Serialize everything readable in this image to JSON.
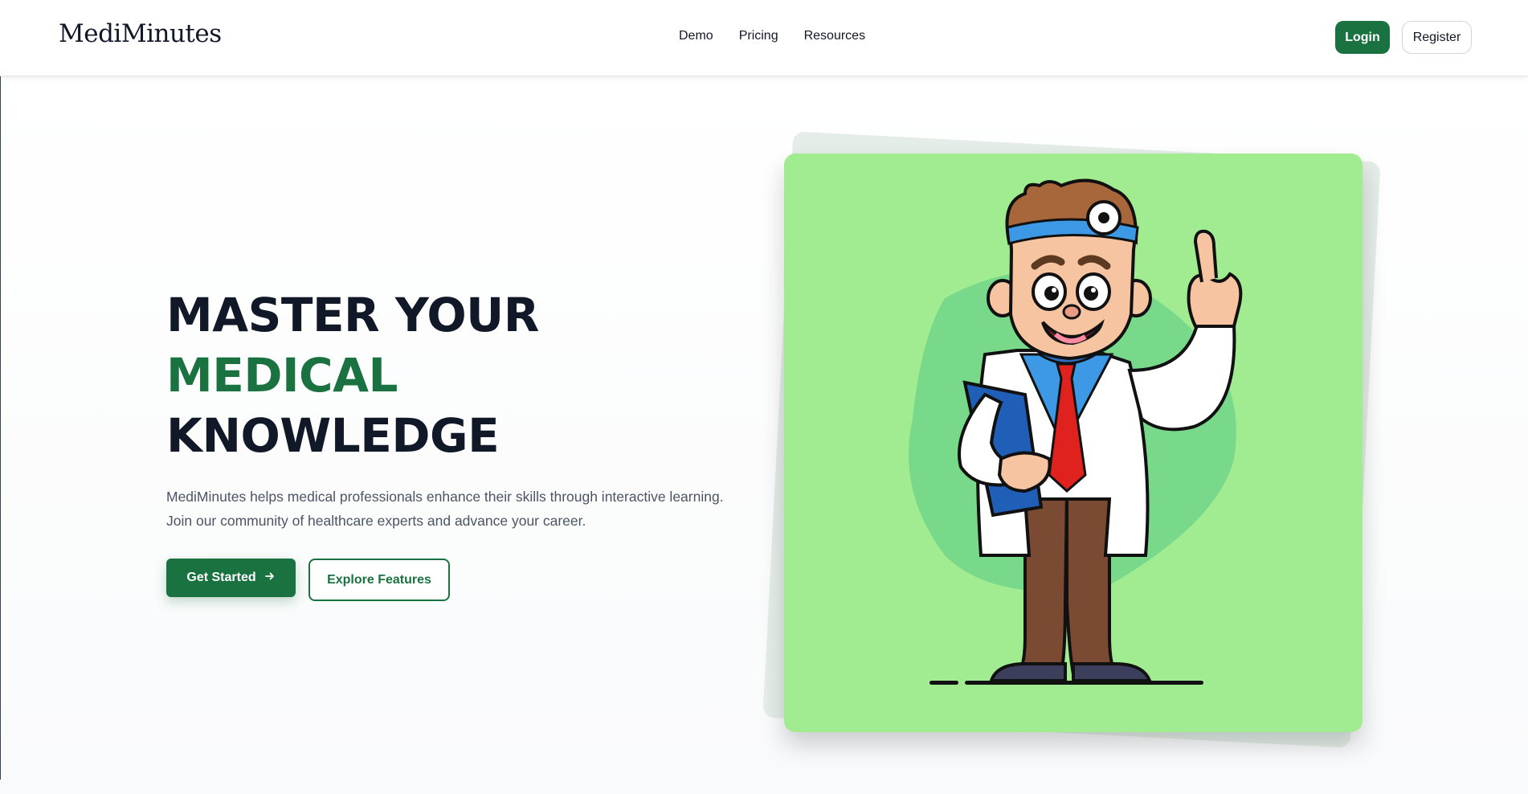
{
  "header": {
    "logo": "MediMinutes",
    "nav": [
      "Demo",
      "Pricing",
      "Resources"
    ],
    "login_label": "Login",
    "register_label": "Register"
  },
  "hero": {
    "title_line1": "MASTER YOUR",
    "title_line2": "MEDICAL",
    "title_line3": "KNOWLEDGE",
    "description": "MediMinutes helps medical professionals enhance their skills through interactive learning. Join our community of healthcare experts and advance your career.",
    "primary_cta": "Get Started",
    "secondary_cta": "Explore Features"
  },
  "colors": {
    "brand": "#1a7240",
    "card_bg": "#a1eb90",
    "heading": "#111827"
  },
  "icons": {
    "cta_arrow": "arrow-right-icon"
  }
}
